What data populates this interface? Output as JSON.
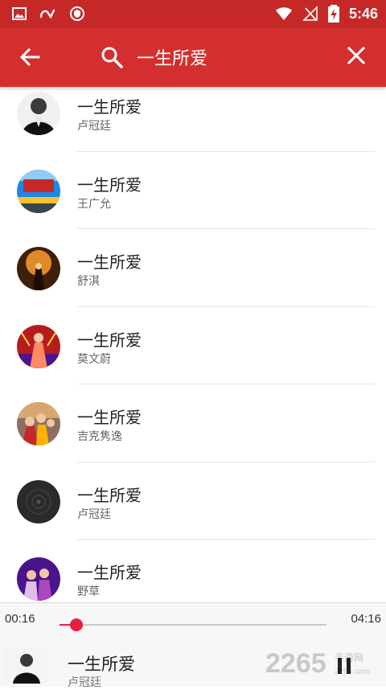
{
  "status_bar": {
    "time": "5:46"
  },
  "search": {
    "query": "一生所爱"
  },
  "results": [
    {
      "title": "一生所爱",
      "artist": "卢冠廷",
      "cover": "portrait-bald-man"
    },
    {
      "title": "一生所爱",
      "artist": "王广允",
      "cover": "album-poster-blue"
    },
    {
      "title": "一生所爱",
      "artist": "舒淇",
      "cover": "movie-poster-warm"
    },
    {
      "title": "一生所爱",
      "artist": "莫文蔚",
      "cover": "stage-performer-red"
    },
    {
      "title": "一生所爱",
      "artist": "吉克隽逸",
      "cover": "movie-poster-group"
    },
    {
      "title": "一生所爱",
      "artist": "卢冠廷",
      "cover": "vinyl-record"
    },
    {
      "title": "一生所爱",
      "artist": "野草",
      "cover": "group-photo-purple"
    }
  ],
  "player": {
    "elapsed": "00:16",
    "total": "04:16",
    "progress_fraction": 0.0625,
    "title": "一生所爱",
    "artist": "卢冠廷"
  },
  "watermark": {
    "logo_text": "2265手游网",
    "url": "2265.com"
  },
  "colors": {
    "header": "#d32f2f",
    "status": "#c62828",
    "accent": "#e91e3f"
  }
}
